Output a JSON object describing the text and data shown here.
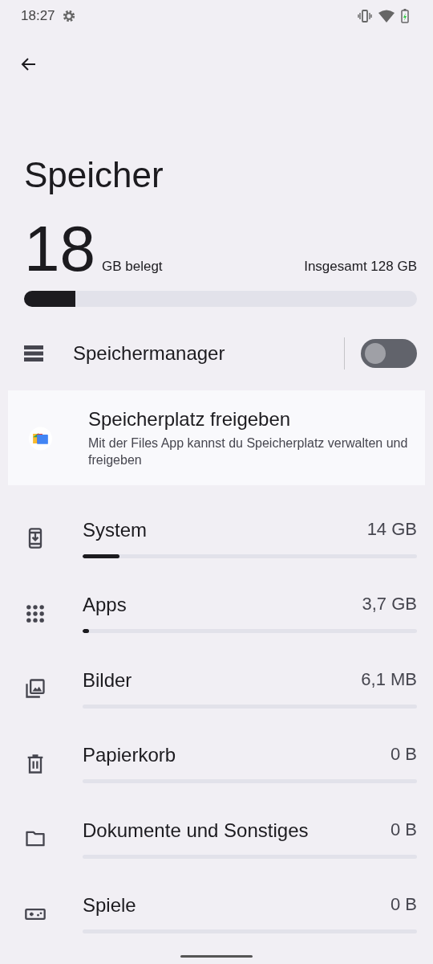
{
  "status_bar": {
    "time": "18:27"
  },
  "title": "Speicher",
  "usage": {
    "amount": "18",
    "unit": "GB belegt",
    "total": "Insgesamt 128 GB",
    "level": 0.13
  },
  "storage_manager": {
    "label": "Speichermanager",
    "on": false
  },
  "free_up_card": {
    "title": "Speicherplatz freigeben",
    "description": "Mit der Files App kannst du Speicherplatz verwalten und freigeben"
  },
  "categories": [
    {
      "kind": "system",
      "name": "System",
      "size": "14 GB",
      "level": 0.11
    },
    {
      "kind": "apps",
      "name": "Apps",
      "size": "3,7 GB",
      "level": 0.02
    },
    {
      "kind": "images",
      "name": "Bilder",
      "size": "6,1 MB"
    },
    {
      "kind": "trash",
      "name": "Papierkorb",
      "size": "0 B"
    },
    {
      "kind": "documents",
      "name": "Dokumente und Sonstiges",
      "size": "0 B"
    },
    {
      "kind": "games",
      "name": "Spiele",
      "size": "0 B"
    }
  ]
}
